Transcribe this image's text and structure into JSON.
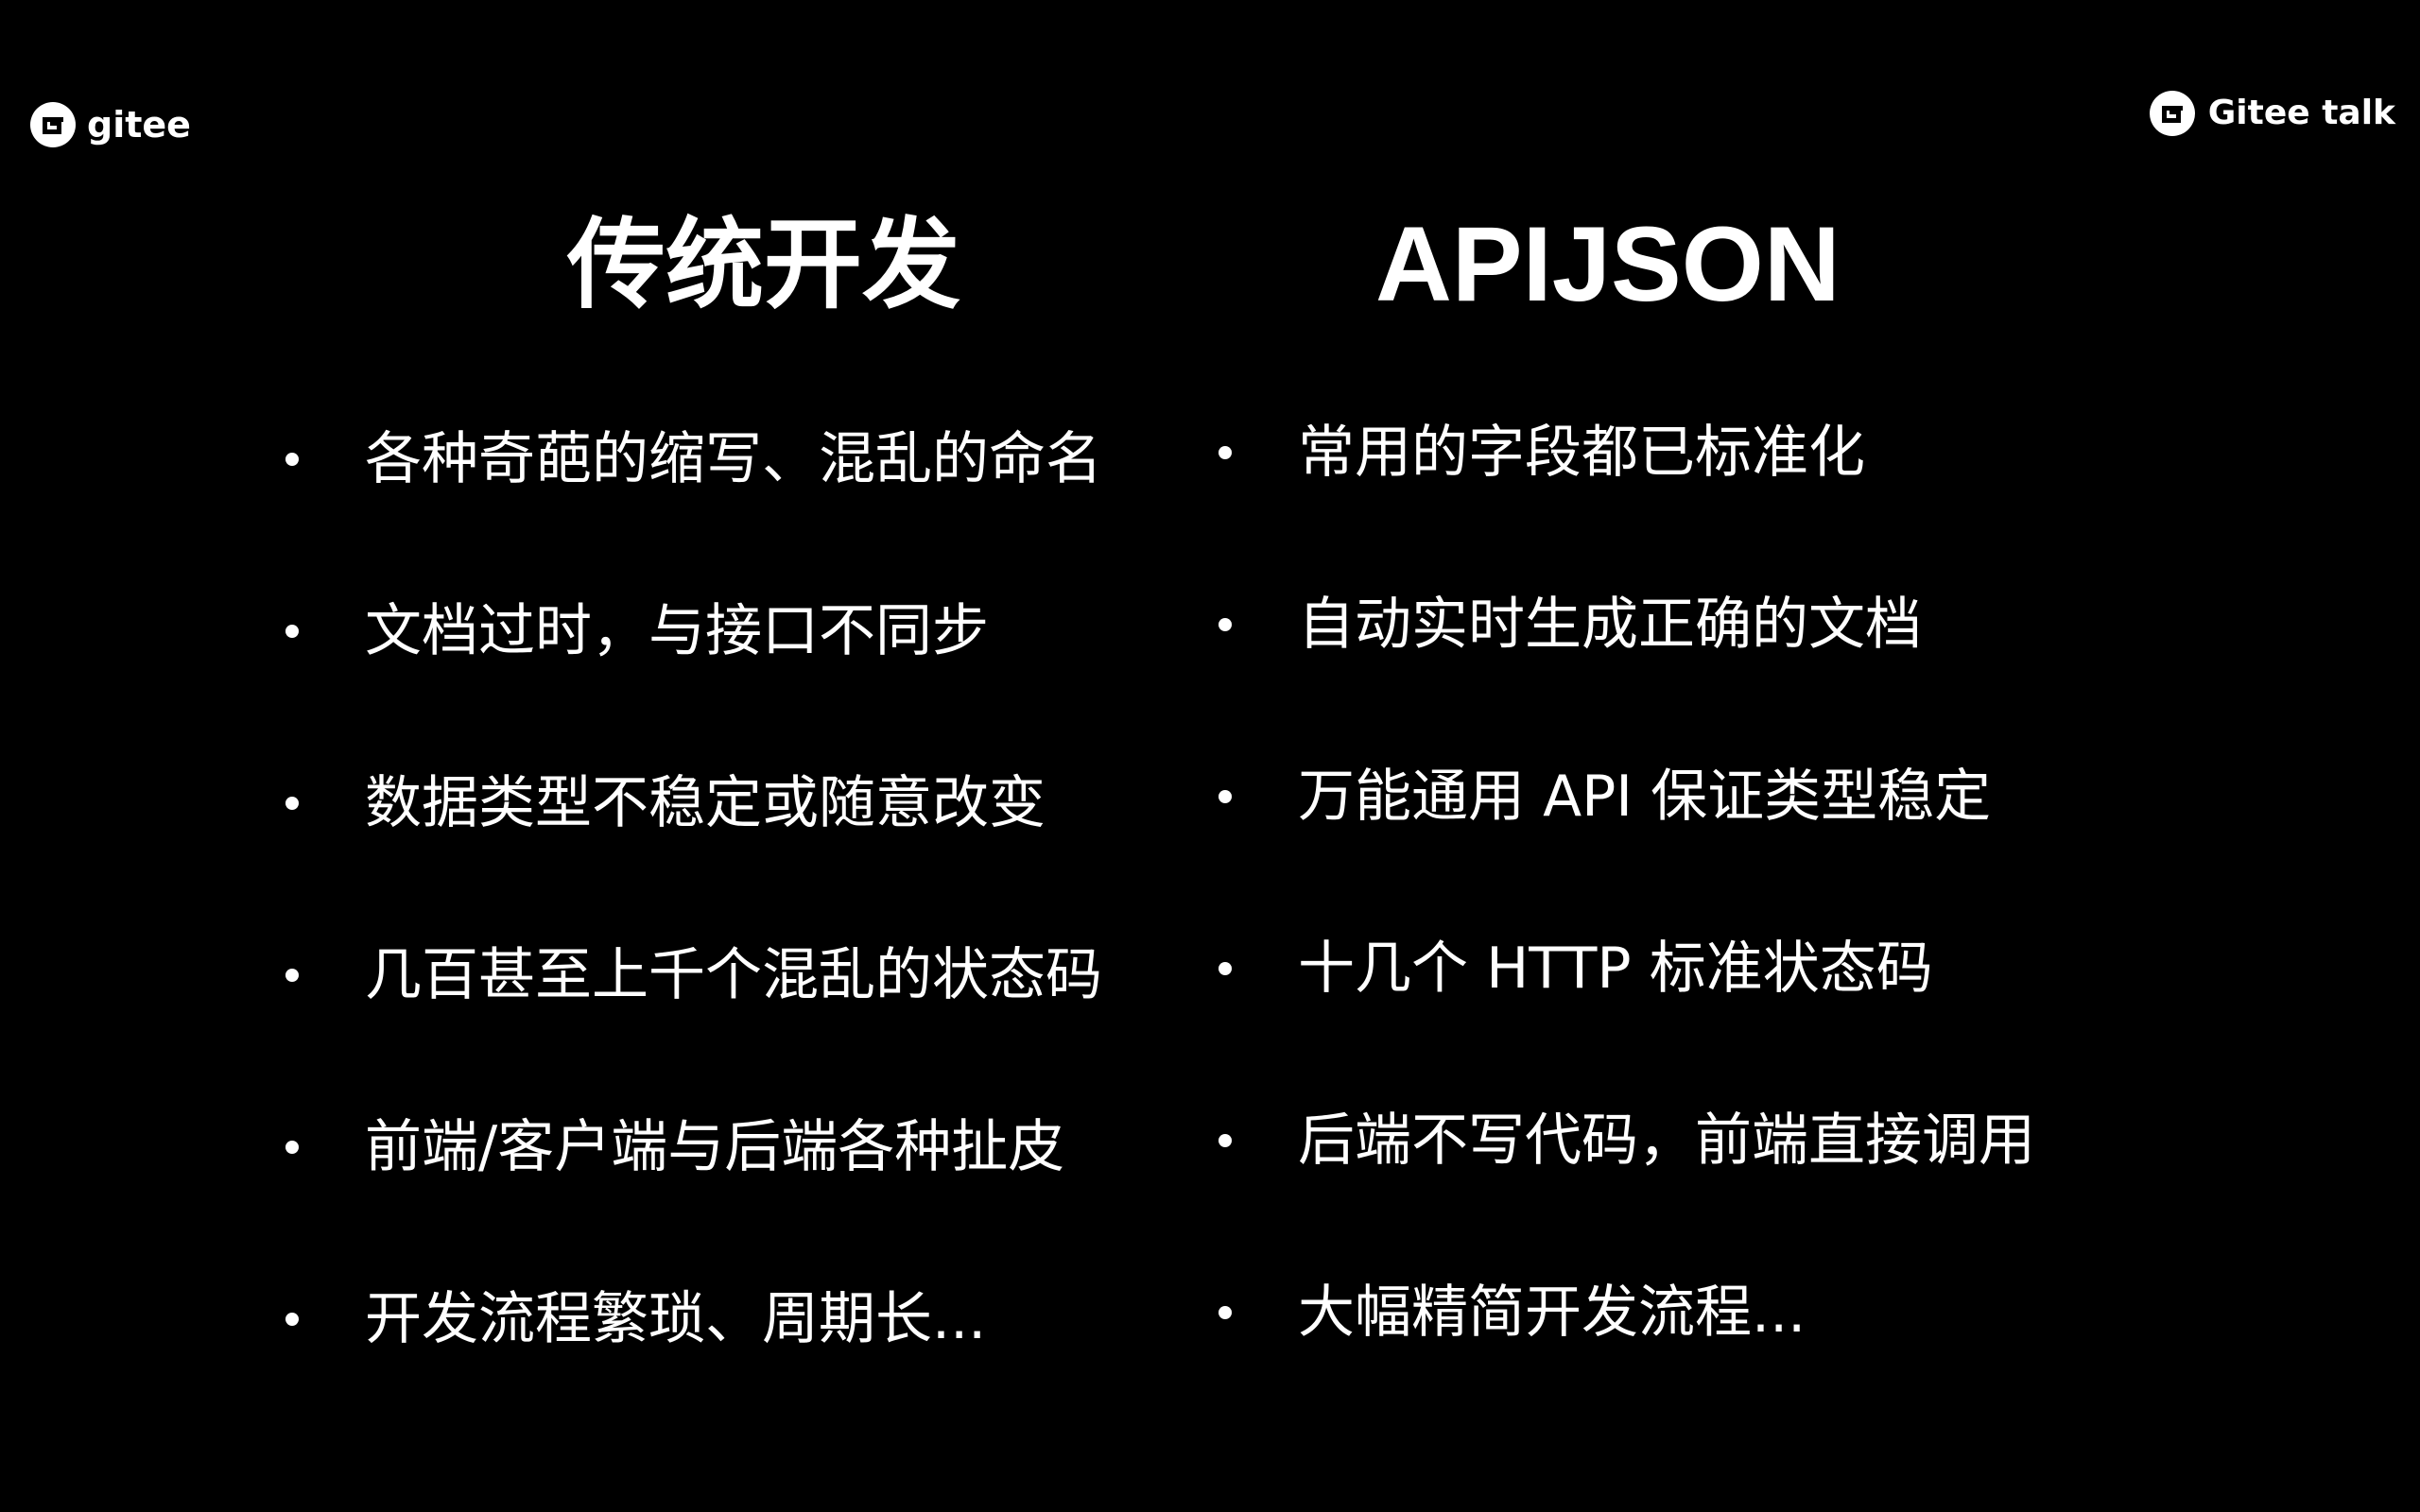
{
  "logos": {
    "left": {
      "text": "gitee",
      "icon": "gitee-g-icon"
    },
    "right": {
      "text": "Gitee talk",
      "icon": "gitee-g-icon"
    }
  },
  "columns": {
    "left": {
      "title": "传统开发",
      "items": [
        "各种奇葩的缩写、混乱的命名",
        "文档过时，与接口不同步",
        "数据类型不稳定或随意改变",
        "几百甚至上千个混乱的状态码",
        "前端/客户端与后端各种扯皮",
        "开发流程繁琐、周期长..."
      ]
    },
    "right": {
      "title": "APIJSON",
      "items": [
        "常用的字段都已标准化",
        "自动实时生成正确的文档",
        "万能通用 API 保证类型稳定",
        "十几个 HTTP 标准状态码",
        "后端不写代码，前端直接调用",
        "大幅精简开发流程..."
      ]
    }
  },
  "colors": {
    "background": "#000000",
    "text": "#ffffff"
  }
}
